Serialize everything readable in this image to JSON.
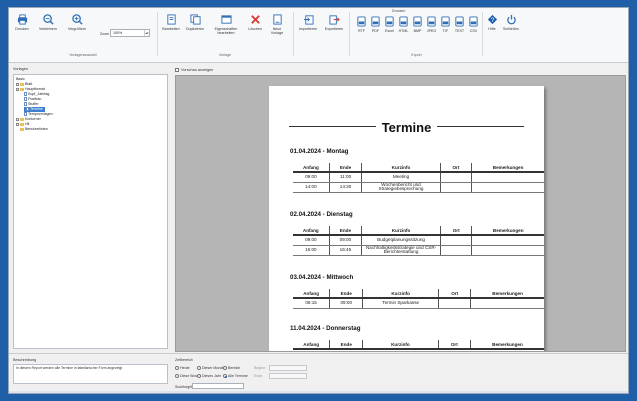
{
  "ribbon": {
    "zoom_label": "Zoom",
    "zoom_value": "100%",
    "drucken_header": "Drucken",
    "buttons": {
      "drucken": "Drucken",
      "verkleinern": "Verkleinern",
      "vergroessern": "Vergrößern",
      "bearbeiten": "Bearbeiten",
      "duplizieren": "Duplizieren",
      "eigenschaften": "Eigenschaften bearbeiten",
      "loeschen": "Löschen",
      "neue_vorlage": "Neue Vorlage",
      "importieren": "Importieren",
      "exportieren": "Exportieren",
      "hilfe": "Hilfe",
      "schliessen": "Schließen"
    },
    "exports": [
      "RTF",
      "PDF",
      "Excel",
      "HTML",
      "BMP",
      "JPEG",
      "TIF",
      "TEXT",
      "CSV"
    ],
    "groups": {
      "vorlagenauswahl": "Vorlagenauswahl",
      "vorlage": "Vorlage",
      "export": "Export"
    },
    "colors": {
      "icon_blue": "#2f6fb7",
      "delete_red": "#d83a2e",
      "help_blue": "#1f5fa8"
    }
  },
  "left_panel": {
    "title": "Vorlagen",
    "tree": [
      "Basic",
      "Blatt",
      "Hauptformat",
      "Kopf_Jahrtag",
      "Postfrau",
      "Stuffer",
      "Termine",
      "Tempovorlagen",
      "Kontorner",
      "Hit",
      "Benutzerlisten"
    ]
  },
  "preview": {
    "show_preview_label": "Vorschau anzeigen",
    "doc_title": "Termine",
    "headers": [
      "Anfang",
      "Ende",
      "Kurzinfo",
      "Ort",
      "Bemerkungen"
    ],
    "days": [
      {
        "title": "01.04.2024 - Montag",
        "rows": [
          {
            "start": "09:00",
            "end": "11:00",
            "info": "Meeting",
            "ort": "",
            "note": ""
          },
          {
            "start": "14:00",
            "end": "14:30",
            "info": "Wochenbericht und Strategiebesprechung",
            "ort": "",
            "note": ""
          }
        ]
      },
      {
        "title": "02.04.2024 - Dienstag",
        "rows": [
          {
            "start": "09:00",
            "end": "09:00",
            "info": "Budgetplanungssitzung",
            "ort": "",
            "note": ""
          },
          {
            "start": "16:00",
            "end": "16:45",
            "info": "Nachhaltigkeitsstrategie und CSR-Berichterstattung",
            "ort": "",
            "note": ""
          }
        ]
      },
      {
        "title": "03.04.2024 - Mittwoch",
        "rows": [
          {
            "start": "08:15",
            "end": "09:00",
            "info": "Termin Sparkasse",
            "ort": "",
            "note": ""
          }
        ]
      },
      {
        "title": "11.04.2024 - Donnerstag",
        "rows": []
      }
    ]
  },
  "bottom": {
    "description_title": "Beschreibung",
    "description_text": "In diesem Report werden alle Termine in tabellarischer Form angezeigt",
    "range_title": "Zeitbereich",
    "radios": [
      "Heute",
      "Diese Woche",
      "Dieser Monat",
      "Dieses Jahr",
      "Bereich",
      "Alle Termine"
    ],
    "selected_radio": "Alle Termine",
    "von_label": "Beginn",
    "bis_label": "Ende",
    "search_label": "Suchbegriff"
  }
}
